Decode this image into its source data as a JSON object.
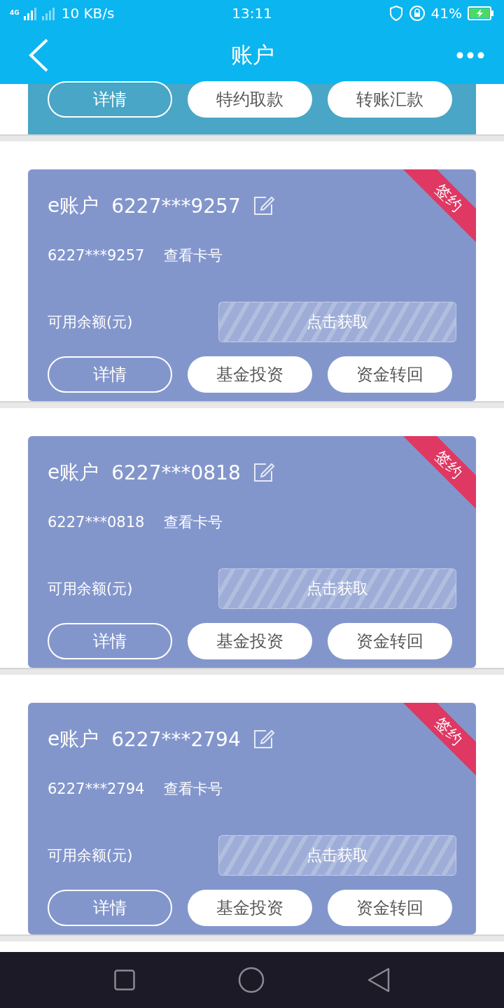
{
  "status_bar": {
    "network": "4G",
    "speed": "10 KB/s",
    "time": "13:11",
    "battery": "41%"
  },
  "header": {
    "title": "账户"
  },
  "top_card": {
    "buttons": [
      {
        "label": "详情",
        "kind": "outline"
      },
      {
        "label": "特约取款",
        "kind": "filled"
      },
      {
        "label": "转账汇款",
        "kind": "filled"
      }
    ]
  },
  "accounts": [
    {
      "name": "e账户",
      "number": "6227***9257",
      "card_number": "6227***9257",
      "view_label": "查看卡号",
      "badge": "签约",
      "balance_label": "可用余额(元)",
      "balance_action": "点击获取",
      "buttons": [
        {
          "label": "详情",
          "kind": "outline"
        },
        {
          "label": "基金投资",
          "kind": "filled"
        },
        {
          "label": "资金转回",
          "kind": "filled"
        }
      ]
    },
    {
      "name": "e账户",
      "number": "6227***0818",
      "card_number": "6227***0818",
      "view_label": "查看卡号",
      "badge": "签约",
      "balance_label": "可用余额(元)",
      "balance_action": "点击获取",
      "buttons": [
        {
          "label": "详情",
          "kind": "outline"
        },
        {
          "label": "基金投资",
          "kind": "filled"
        },
        {
          "label": "资金转回",
          "kind": "filled"
        }
      ]
    },
    {
      "name": "e账户",
      "number": "6227***2794",
      "card_number": "6227***2794",
      "view_label": "查看卡号",
      "badge": "签约",
      "balance_label": "可用余额(元)",
      "balance_action": "点击获取",
      "buttons": [
        {
          "label": "详情",
          "kind": "outline"
        },
        {
          "label": "基金投资",
          "kind": "filled"
        },
        {
          "label": "资金转回",
          "kind": "filled"
        }
      ]
    }
  ]
}
